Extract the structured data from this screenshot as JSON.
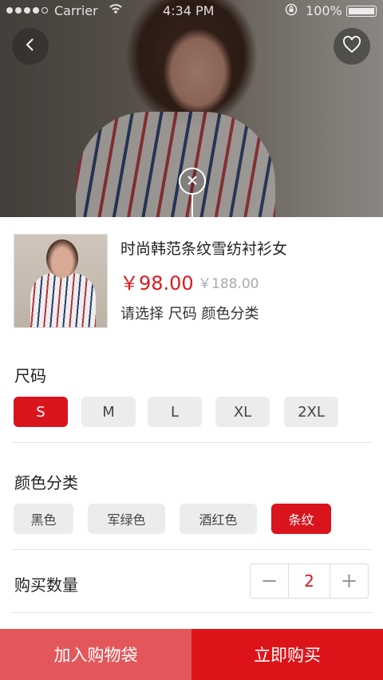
{
  "status_bar": {
    "carrier": "Carrier",
    "time": "4:34 PM",
    "battery": "100%",
    "wifi_icon": "wifi-icon",
    "lock_icon": "rotation-lock-icon"
  },
  "header": {
    "back_icon": "chevron-left-icon",
    "favorite_icon": "heart-icon",
    "close_icon": "close-icon"
  },
  "product": {
    "title": "时尚韩范条纹雪纺衬衫女",
    "price": "￥98.00",
    "original_price": "￥188.00",
    "hint": "请选择 尺码 颜色分类"
  },
  "size_section": {
    "title": "尺码",
    "options": [
      "S",
      "M",
      "L",
      "XL",
      "2XL"
    ],
    "selected": "S"
  },
  "color_section": {
    "title": "颜色分类",
    "options": [
      "黑色",
      "军绿色",
      "酒红色",
      "条纹"
    ],
    "selected": "条纹"
  },
  "quantity": {
    "title": "购买数量",
    "value": "2",
    "minus": "−",
    "plus": "+"
  },
  "actions": {
    "add_to_bag": "加入购物袋",
    "buy_now": "立即购买"
  },
  "colors": {
    "accent": "#d9141d",
    "add_button": "#e3575a"
  }
}
